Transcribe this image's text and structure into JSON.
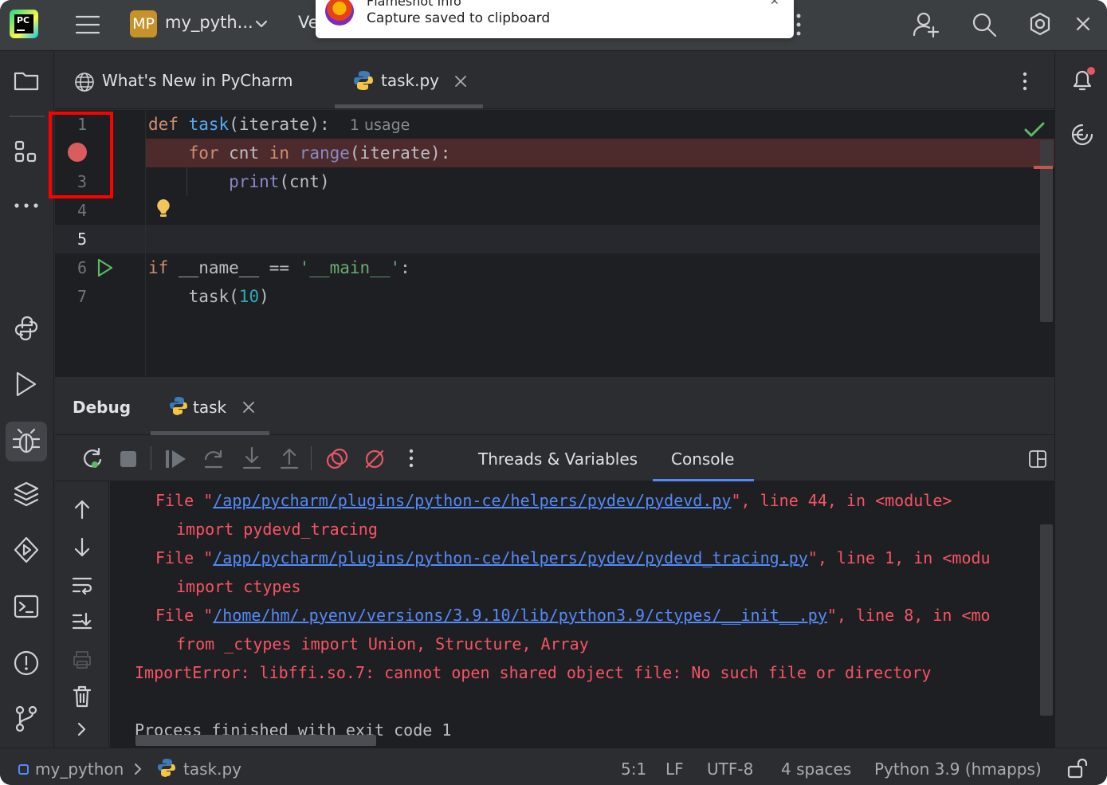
{
  "titlebar": {
    "project_badge": "MP",
    "project_name": "my_pyth...",
    "vcs_label": "Ve"
  },
  "notification": {
    "title": "Flameshot Info",
    "message": "Capture saved to clipboard"
  },
  "editor_tabs": [
    {
      "label": "What's New in PyCharm"
    },
    {
      "label": "task.py",
      "active": true
    }
  ],
  "editor": {
    "line_numbers": [
      "1",
      "",
      "3",
      "4",
      "5",
      "6",
      "7"
    ],
    "usage_hint": "1 usage",
    "breakpoint_line": 2,
    "caret_line": 5
  },
  "debug": {
    "title": "Debug",
    "session_tab": "task",
    "inner_tabs": [
      "Threads & Variables",
      "Console"
    ],
    "active_inner_tab": "Console"
  },
  "console_lines": [
    {
      "type": "file",
      "prefix": "File \"",
      "link": "/app/pycharm/plugins/python-ce/helpers/pydev/pydevd.py",
      "suffix": "\", line 44, in <module>"
    },
    {
      "type": "code",
      "text": "import pydevd_tracing"
    },
    {
      "type": "file",
      "prefix": "File \"",
      "link": "/app/pycharm/plugins/python-ce/helpers/pydev/pydevd_tracing.py",
      "suffix": "\", line 1, in <modu"
    },
    {
      "type": "code",
      "text": "import ctypes"
    },
    {
      "type": "file",
      "prefix": "File \"",
      "link": "/home/hm/.pyenv/versions/3.9.10/lib/python3.9/ctypes/__init__.py",
      "suffix": "\", line 8, in <mo"
    },
    {
      "type": "code",
      "text": "from _ctypes import Union, Structure, Array"
    },
    {
      "type": "error",
      "text": "ImportError: libffi.so.7: cannot open shared object file: No such file or directory"
    },
    {
      "type": "normal",
      "text": "Process finished with exit code 1"
    }
  ],
  "statusbar": {
    "project": "my_python",
    "file": "task.py",
    "position": "5:1",
    "line_sep": "LF",
    "encoding": "UTF-8",
    "indent": "4 spaces",
    "interpreter": "Python 3.9 (hmapps)"
  },
  "colors": {
    "background": "#2b2d30",
    "editor_bg": "#1e1f22",
    "keyword": "#cf8e6d",
    "function": "#56a8f5",
    "builtin": "#8888c6",
    "string": "#6aab73",
    "number": "#2aacb8",
    "error_text": "#f75464",
    "link": "#548af7",
    "breakpoint": "#db5c5c",
    "annotation_box": "#ff0000"
  }
}
